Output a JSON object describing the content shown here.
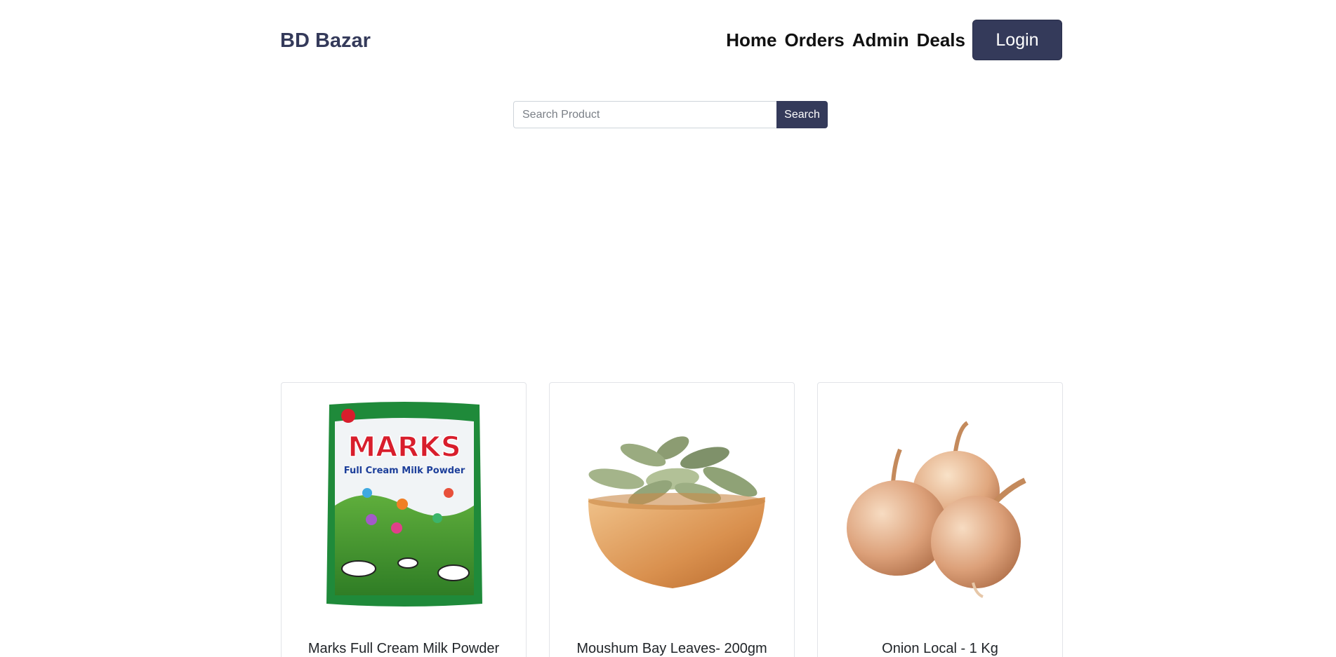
{
  "brand": "BD Bazar",
  "nav": {
    "home": "Home",
    "orders": "Orders",
    "admin": "Admin",
    "deals": "Deals",
    "login": "Login"
  },
  "search": {
    "placeholder": "Search Product",
    "value": "",
    "button": "Search"
  },
  "colors": {
    "primary": "#343a5a"
  },
  "products": [
    {
      "name": "Marks Full Cream Milk Powder",
      "image": "milk-powder-pack",
      "pack_brand": "MARKS",
      "pack_line": "Full Cream Milk Powder"
    },
    {
      "name": "Moushum Bay Leaves- 200gm",
      "image": "bay-leaves-bowl"
    },
    {
      "name": "Onion Local - 1 Kg",
      "image": "onions"
    }
  ]
}
